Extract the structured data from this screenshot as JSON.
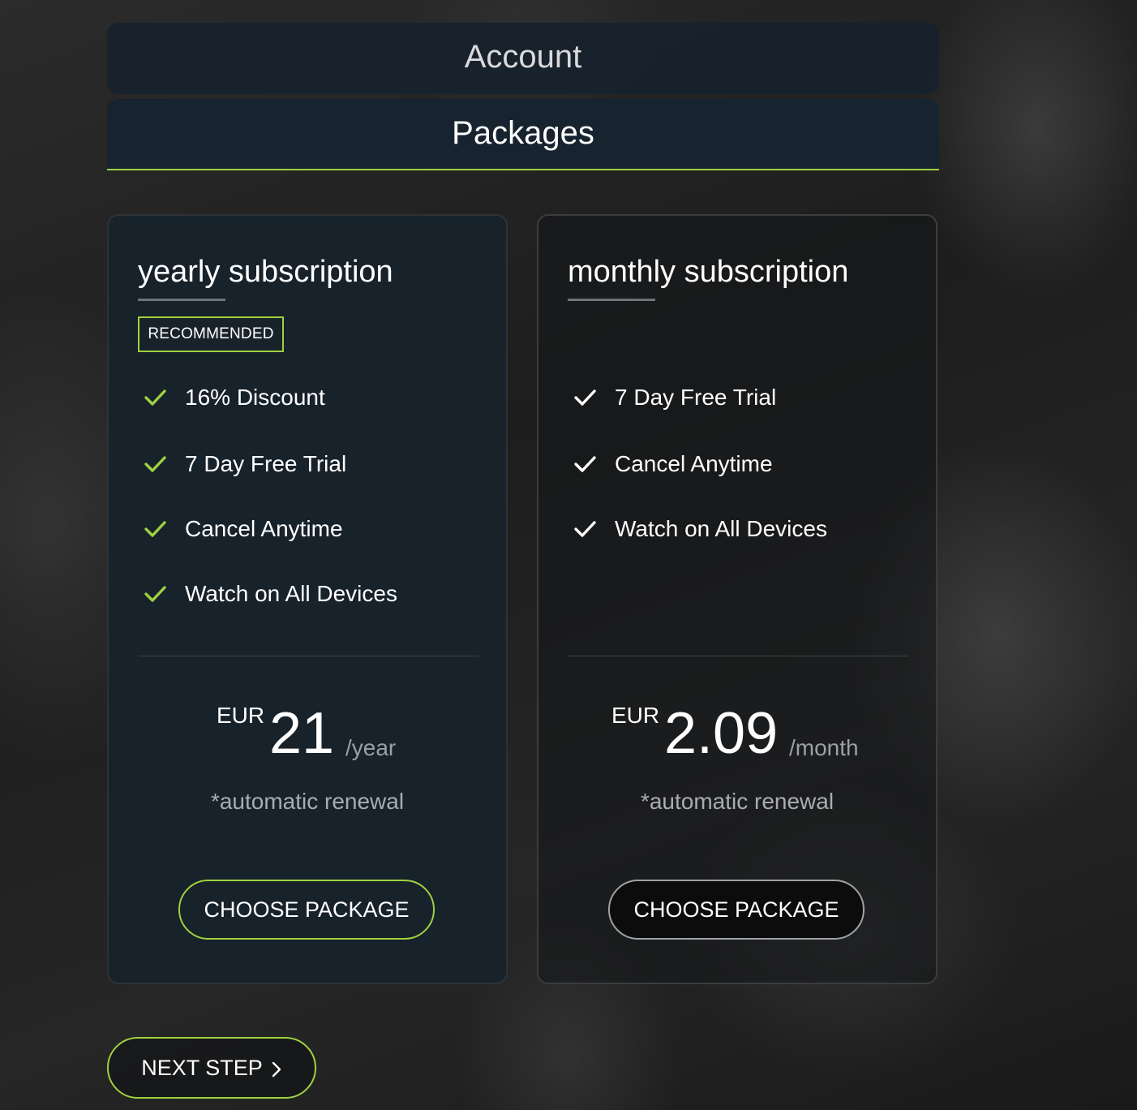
{
  "accordion": {
    "account_label": "Account",
    "packages_label": "Packages"
  },
  "colors": {
    "accent": "#9fd13f",
    "panel": "#17222b",
    "text": "#ffffff",
    "muted": "#a9adb1"
  },
  "packages": [
    {
      "title": "yearly subscription",
      "badge": "RECOMMENDED",
      "features": [
        "16% Discount",
        "7 Day Free Trial",
        "Cancel Anytime",
        "Watch on All Devices"
      ],
      "currency": "EUR",
      "amount": "21",
      "period": "/year",
      "renewal_note": "*automatic renewal",
      "button_label": "CHOOSE PACKAGE",
      "selected": true,
      "check_icon": "check-icon-green"
    },
    {
      "title": "monthly subscription",
      "badge": "",
      "features": [
        "7 Day Free Trial",
        "Cancel Anytime",
        "Watch on All Devices"
      ],
      "currency": "EUR",
      "amount": "2.09",
      "period": "/month",
      "renewal_note": "*automatic renewal",
      "button_label": "CHOOSE PACKAGE",
      "selected": false,
      "check_icon": "check-icon-white"
    }
  ],
  "footer": {
    "next_step_label": "NEXT STEP",
    "next_icon": "chevron-right-icon"
  }
}
